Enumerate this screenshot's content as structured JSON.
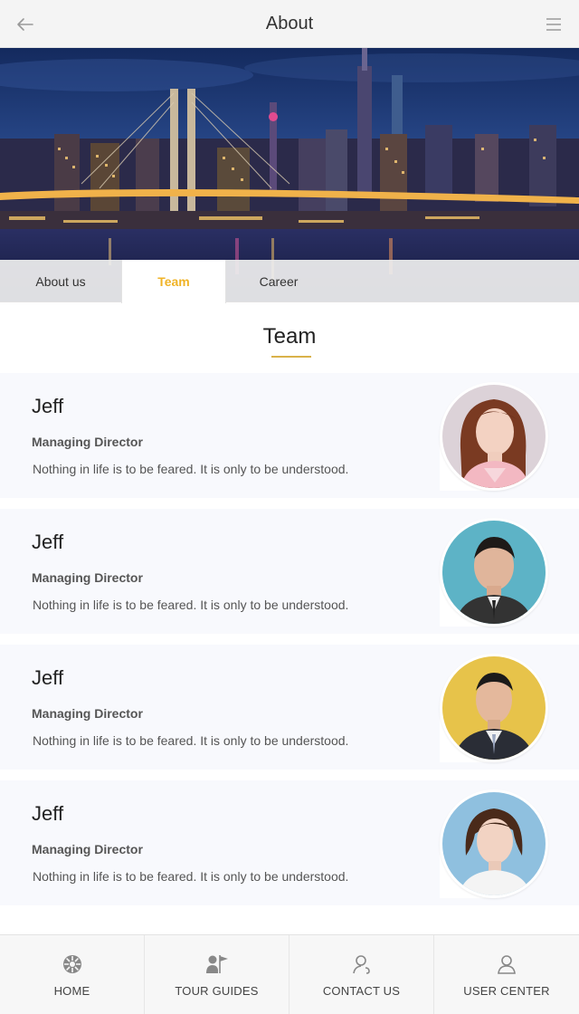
{
  "header": {
    "title": "About",
    "back_icon": "arrow-left-icon",
    "menu_icon": "hamburger-menu-icon"
  },
  "banner": {
    "image": "city-night-skyline-photo"
  },
  "tabs": [
    {
      "label": "About us",
      "active": false
    },
    {
      "label": "Team",
      "active": true
    },
    {
      "label": "Career",
      "active": false
    }
  ],
  "section": {
    "title": "Team"
  },
  "team": [
    {
      "name": "Jeff",
      "role": "Managing Director",
      "bio": "Nothing in life is to be feared. It is only to be understood.",
      "avatar": "woman-portrait-pink"
    },
    {
      "name": "Jeff",
      "role": "Managing Director",
      "bio": "Nothing in life is to be feared. It is only to be understood.",
      "avatar": "man-portrait-blue"
    },
    {
      "name": "Jeff",
      "role": "Managing Director",
      "bio": "Nothing in life is to be feared. It is only to be understood.",
      "avatar": "man-portrait-yellow"
    },
    {
      "name": "Jeff",
      "role": "Managing Director",
      "bio": "Nothing in life is to be feared. It is only to be understood.",
      "avatar": "woman-portrait-lightblue"
    }
  ],
  "bottom_nav": [
    {
      "label": "HOME",
      "icon": "home-dial-icon"
    },
    {
      "label": "TOUR GUIDES",
      "icon": "guide-flag-icon"
    },
    {
      "label": "CONTACT US",
      "icon": "contact-user-icon"
    },
    {
      "label": "USER CENTER",
      "icon": "user-icon"
    }
  ],
  "colors": {
    "accent": "#f0b326",
    "underline": "#d9b24a",
    "card_bg": "#f8f9fd",
    "header_bg": "#f4f4f4"
  }
}
